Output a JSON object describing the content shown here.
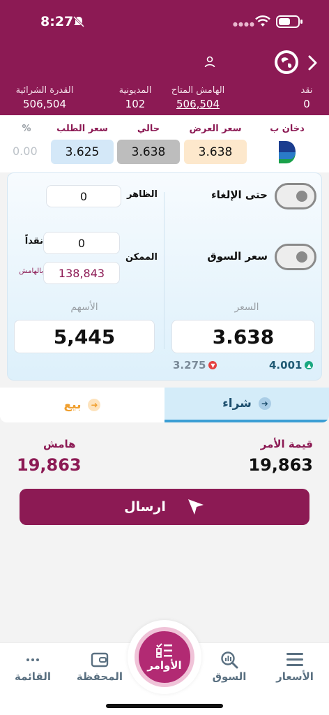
{
  "status_bar": {
    "time": "8:27"
  },
  "header": {
    "stats": [
      {
        "label": "نقد",
        "value": "0"
      },
      {
        "label": "الهامش المتاح",
        "value": "506,504"
      },
      {
        "label": "المديونية",
        "value": "102"
      },
      {
        "label": "القدرة الشرائية",
        "value": "506,504"
      }
    ]
  },
  "quote": {
    "symbol": "دخان ب",
    "ask_label": "سعر العرض",
    "ask_value": "3.638",
    "last_label": "حالي",
    "last_value": "3.638",
    "bid_label": "سعر الطلب",
    "bid_value": "3.625",
    "change_label": "%",
    "change_value": "0.00"
  },
  "order": {
    "gtc_label": "حتى الإلغاء",
    "market_label": "سعر السوق",
    "visible_label": "الظاهر",
    "visible_value": "0",
    "possible_label": "الممكن",
    "cash_label": "نقداً",
    "cash_value": "0",
    "margin_small_label": "بالهامش",
    "margin_value": "138,843",
    "price_label": "السعر",
    "price_value": "3.638",
    "shares_label": "الأسهم",
    "shares_value": "5,445",
    "upper_limit": "4.001",
    "lower_limit": "3.275"
  },
  "tabs": {
    "buy": "شراء",
    "sell": "بيع"
  },
  "summary": {
    "order_value_label": "قيمة الأمر",
    "order_value": "19,863",
    "margin_label": "هامش",
    "margin_value": "19,863"
  },
  "send_button": "ارسال",
  "nav": {
    "prices": "الأسعار",
    "market": "السوق",
    "orders": "الأوامر",
    "portfolio": "المحفظة",
    "menu": "القائمة"
  },
  "colors": {
    "brand": "#8c1a54",
    "accent_blue": "#3b9ed4",
    "sell_orange": "#f0a030"
  }
}
